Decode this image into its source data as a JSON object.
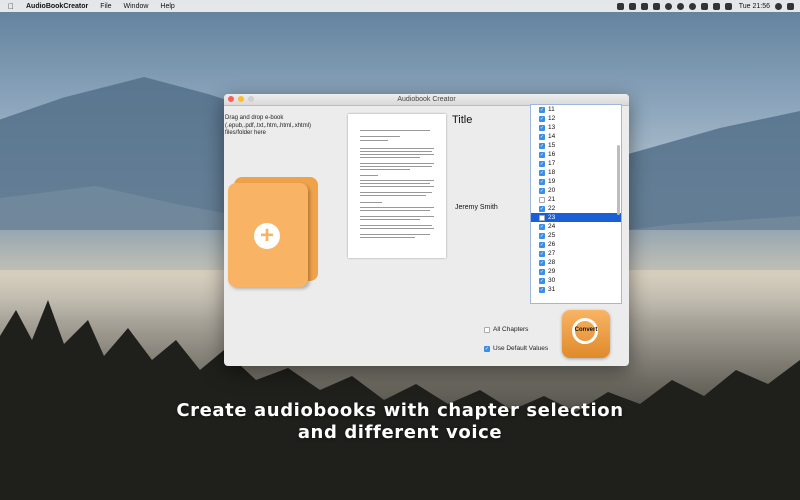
{
  "menubar": {
    "app_name": "AudioBookCreator",
    "menus": [
      "File",
      "Window",
      "Help"
    ],
    "clock": "Tue 21:56"
  },
  "window": {
    "title": "Audiobook Creator",
    "drop_hint": "Drag and drop e-book\n(.epub,.pdf,.txt,.htm,.html,.xhtml)\nfiles/folder here",
    "book_title": "Title",
    "author": "Jeremy Smith",
    "chapters": [
      {
        "label": "11",
        "checked": true
      },
      {
        "label": "12",
        "checked": true
      },
      {
        "label": "13",
        "checked": true
      },
      {
        "label": "14",
        "checked": true
      },
      {
        "label": "15",
        "checked": true
      },
      {
        "label": "16",
        "checked": true
      },
      {
        "label": "17",
        "checked": true
      },
      {
        "label": "18",
        "checked": true
      },
      {
        "label": "19",
        "checked": true
      },
      {
        "label": "20",
        "checked": true
      },
      {
        "label": "21",
        "checked": false
      },
      {
        "label": "22",
        "checked": true
      },
      {
        "label": "23",
        "checked": false,
        "selected": true
      },
      {
        "label": "24",
        "checked": true
      },
      {
        "label": "25",
        "checked": true
      },
      {
        "label": "26",
        "checked": true
      },
      {
        "label": "27",
        "checked": true
      },
      {
        "label": "28",
        "checked": true
      },
      {
        "label": "29",
        "checked": true
      },
      {
        "label": "30",
        "checked": true
      },
      {
        "label": "31",
        "checked": true
      }
    ],
    "all_chapters_label": "All Chapters",
    "all_chapters_checked": false,
    "use_default_label": "Use Default Values",
    "use_default_checked": true,
    "convert_label": "Convert"
  },
  "caption": {
    "line1": "Create audiobooks with chapter selection",
    "line2": "and different voice"
  },
  "colors": {
    "accent": "#f8b464",
    "selection": "#1a5fd6",
    "checkbox": "#3a8ee6"
  }
}
